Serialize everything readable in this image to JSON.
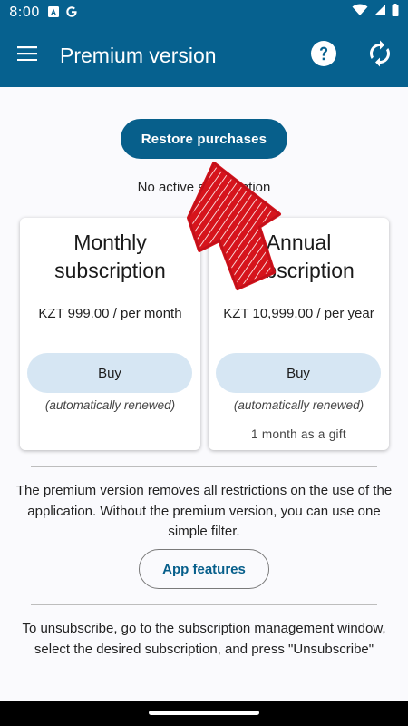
{
  "status_bar": {
    "time": "8:00",
    "icons": [
      "notification-a-icon",
      "google-g-icon",
      "wifi-icon",
      "signal-icon",
      "battery-icon"
    ]
  },
  "app_bar": {
    "title": "Premium version",
    "icons": [
      "menu-icon",
      "help-icon",
      "sync-icon"
    ]
  },
  "restore_button": {
    "label": "Restore purchases"
  },
  "subscription_status": "No active subscription",
  "cards": [
    {
      "title": "Monthly subscription",
      "price": "KZT 999.00 / per month",
      "buy_label": "Buy",
      "note": "(automatically renewed)",
      "gift": ""
    },
    {
      "title": "Annual subscription",
      "price": "KZT 10,999.00 / per year",
      "buy_label": "Buy",
      "note": "(automatically renewed)",
      "gift": "1 month as a gift"
    }
  ],
  "description": "The premium version removes all restrictions on the use of the application. Without the premium version, you can use one simple filter.",
  "features_button": {
    "label": "App features"
  },
  "unsubscribe_text": "To unsubscribe, go to the subscription management window, select the desired subscription, and press \"Unsubscribe\"",
  "colors": {
    "primary": "#06618f",
    "buy_button": "#d6e6f3",
    "annotation": "#d6141c"
  }
}
